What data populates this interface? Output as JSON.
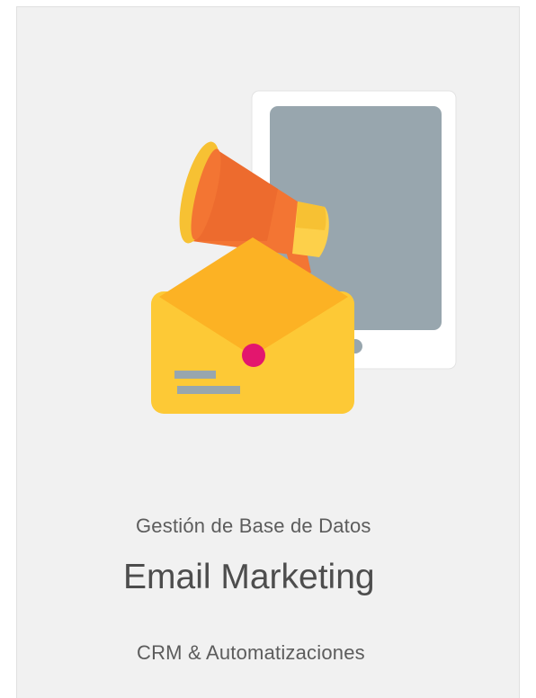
{
  "card": {
    "kicker": "Gestión de Base de Datos",
    "title": "Email Marketing",
    "subtitle": "CRM & Automatizaciones"
  },
  "colors": {
    "card_background": "#f1f1f1",
    "tablet_frame": "#ffffff",
    "tablet_screen": "#98a6ae",
    "envelope": "#fdc936",
    "envelope_flap": "#fcb224",
    "envelope_seal": "#e3166e",
    "megaphone": "#f37533",
    "megaphone_rim": "#f7c133",
    "text": "#4d4d4d"
  },
  "illustration": {
    "icons": [
      "tablet-icon",
      "megaphone-icon",
      "envelope-icon"
    ]
  }
}
